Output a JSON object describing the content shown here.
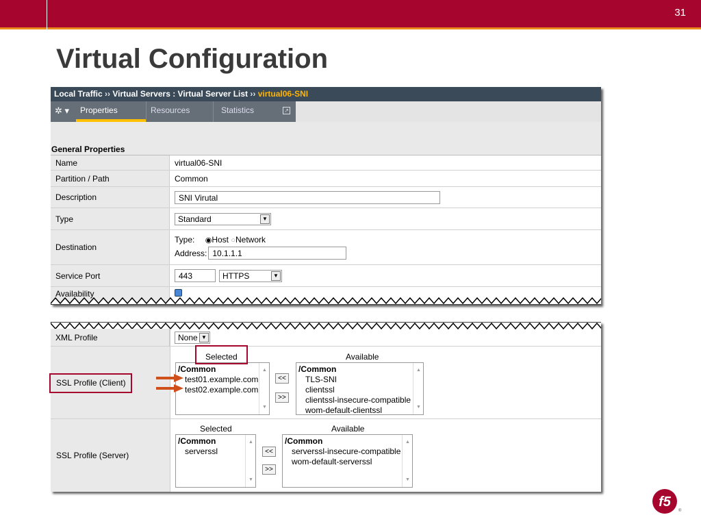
{
  "slide": {
    "number": "31",
    "title": "Virtual Configuration"
  },
  "breadcrumb": {
    "a": "Local Traffic",
    "sep": "››",
    "b": "Virtual Servers",
    "colon": " : ",
    "c": "Virtual Server List",
    "current": "virtual06-SNI"
  },
  "tabs": [
    {
      "label": "Properties"
    },
    {
      "label": "Resources"
    },
    {
      "label": "Statistics"
    }
  ],
  "section_title": "General Properties",
  "fields": {
    "name": {
      "label": "Name",
      "value": "virtual06-SNI"
    },
    "partition": {
      "label": "Partition / Path",
      "value": "Common"
    },
    "description": {
      "label": "Description",
      "value": "SNI Virutal"
    },
    "type": {
      "label": "Type",
      "value": "Standard"
    },
    "destination": {
      "label": "Destination",
      "type_label": "Type:",
      "host_label": "Host",
      "network_label": "Network",
      "address_label": "Address:",
      "address_value": "10.1.1.1"
    },
    "service_port": {
      "label": "Service Port",
      "port": "443",
      "protocol": "HTTPS"
    },
    "availability": {
      "label": "Availability"
    },
    "xml_profile": {
      "label": "XML Profile",
      "value": "None"
    },
    "ssl_client": {
      "label": "SSL Profile (Client)",
      "selected_caption": "Selected",
      "available_caption": "Available",
      "selected_group": "/Common",
      "selected_items": [
        "test01.example.com",
        "test02.example.com"
      ],
      "available_group": "/Common",
      "available_items": [
        "TLS-SNI",
        "clientssl",
        "clientssl-insecure-compatible",
        "wom-default-clientssl"
      ],
      "move_left": "<<",
      "move_right": ">>"
    },
    "ssl_server": {
      "label": "SSL Profile (Server)",
      "selected_caption": "Selected",
      "available_caption": "Available",
      "selected_group": "/Common",
      "selected_items": [
        "serverssl"
      ],
      "available_group": "/Common",
      "available_items": [
        "serverssl-insecure-compatible",
        "wom-default-serverssl"
      ],
      "move_left": "<<",
      "move_right": ">>"
    }
  },
  "colors": {
    "header": "#a6062e",
    "accent": "#e88b1a",
    "nav": "#3b4a59",
    "highlight": "#ffb400"
  },
  "icons": [
    "gear-icon",
    "popout-icon",
    "radio-icon",
    "dropdown-arrow-icon",
    "arrow-right-icon",
    "f5-logo"
  ]
}
